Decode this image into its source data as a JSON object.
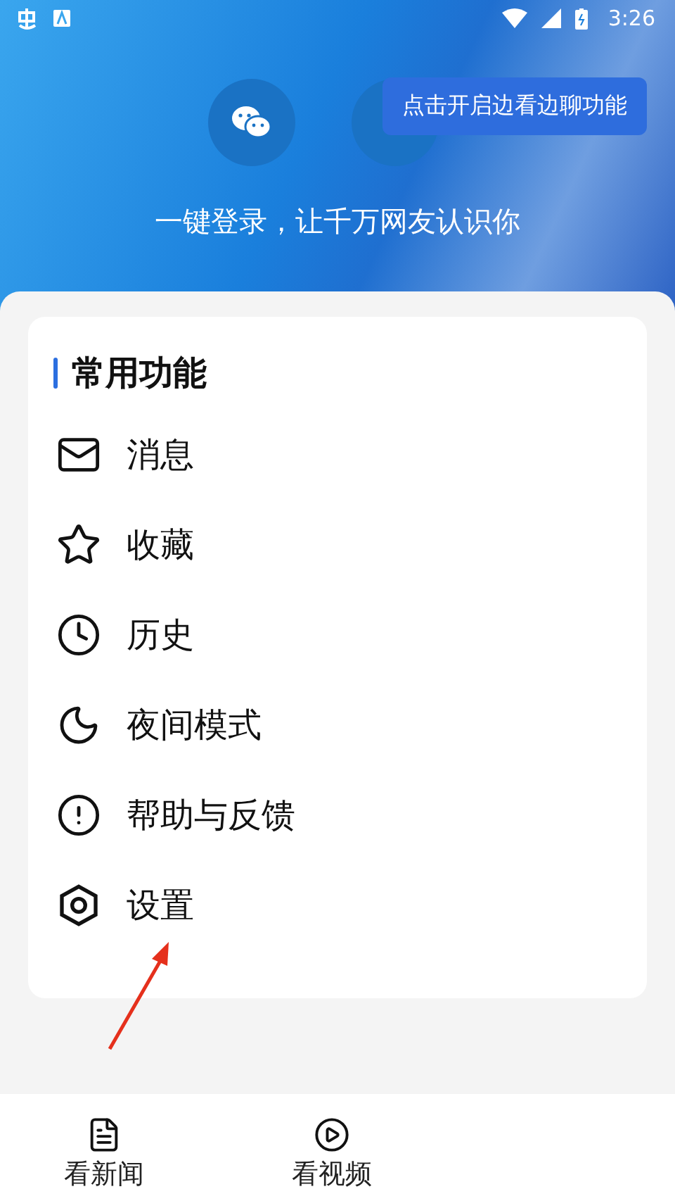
{
  "status_bar": {
    "time": "3:26"
  },
  "header": {
    "tooltip": "点击开启边看边聊功能",
    "slogan": "一键登录，让千万网友认识你"
  },
  "section": {
    "title": "常用功能",
    "items": [
      {
        "label": "消息"
      },
      {
        "label": "收藏"
      },
      {
        "label": "历史"
      },
      {
        "label": "夜间模式"
      },
      {
        "label": "帮助与反馈"
      },
      {
        "label": "设置"
      }
    ]
  },
  "bottom_nav": [
    {
      "label": "看新闻"
    },
    {
      "label": "看视频"
    }
  ]
}
